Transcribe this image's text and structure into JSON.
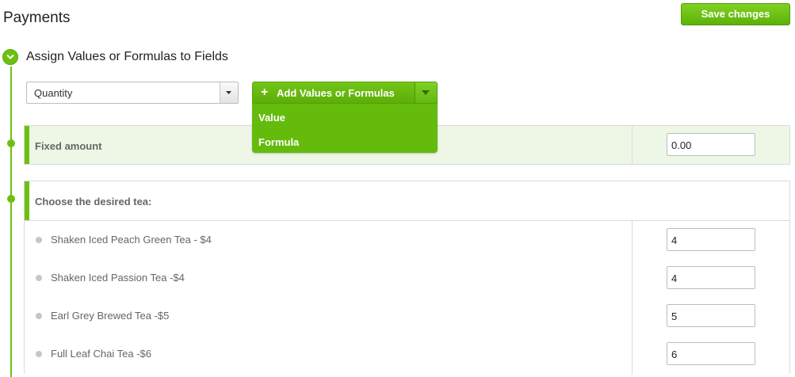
{
  "header": {
    "title": "Payments",
    "save_label": "Save changes"
  },
  "step": {
    "title": "Assign Values or Formulas to Fields"
  },
  "field_select": {
    "selected": "Quantity"
  },
  "add_button": {
    "label": "Add Values or Formulas"
  },
  "dropdown": {
    "items": [
      "Value",
      "Formula"
    ]
  },
  "fixed_amount": {
    "label": "Fixed amount",
    "value": "0.00"
  },
  "tea": {
    "question": "Choose the desired tea:",
    "options": [
      {
        "label": "Shaken Iced Peach Green Tea - $4",
        "value": "4"
      },
      {
        "label": "Shaken Iced Passion Tea -$4",
        "value": "4"
      },
      {
        "label": "Earl Grey Brewed Tea -$5",
        "value": "5"
      },
      {
        "label": "Full Leaf Chai Tea -$6",
        "value": "6"
      }
    ]
  },
  "colors": {
    "accent": "#6cc00f",
    "accent_dark": "#5aa80a",
    "panel_highlight": "#eef7e6"
  },
  "icons": [
    "chevron-down-icon",
    "plus-icon",
    "caret-down-icon"
  ]
}
